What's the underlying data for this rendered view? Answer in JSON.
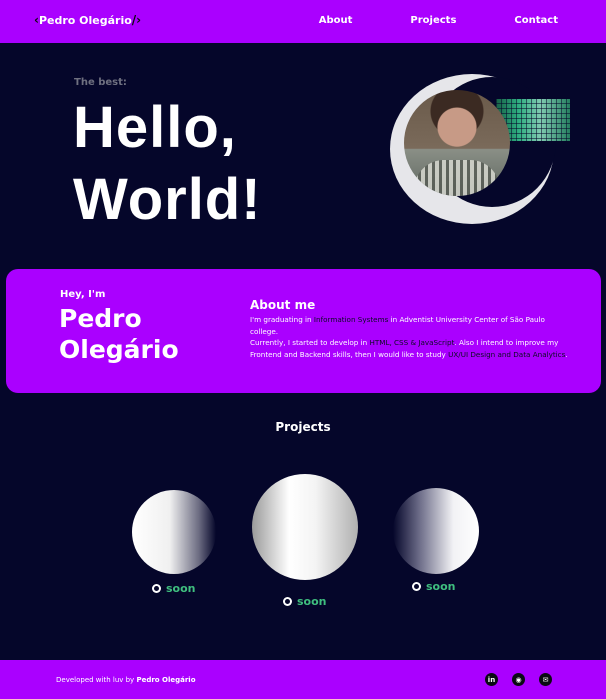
{
  "nav": {
    "logo_open": "‹",
    "logo_name": "Pedro Olegário",
    "logo_close": "/›",
    "links": [
      "About",
      "Projects",
      "Contact"
    ]
  },
  "hero": {
    "eyebrow": "The best:",
    "title_line1": "Hello,",
    "title_line2": "World!"
  },
  "about": {
    "greeting": "Hey, I'm",
    "name_line1": "Pedro",
    "name_line2": "Olegário",
    "heading": "About me",
    "p1_a": "I'm graduating in ",
    "p1_hl": "Information Systems",
    "p1_b": " in Adventist University Center of São Paulo college.",
    "p2_a": "Currently, I started to develop in ",
    "p2_hl1": "HTML, CSS & JavaScript",
    "p2_b": ". Also I intend to improve my Frontend and Backend skills, then I would like to study ",
    "p2_hl2": "UX/UI Design and Data Analytics",
    "p2_c": "."
  },
  "projects": {
    "title": "Projects",
    "items": [
      {
        "label": "soon"
      },
      {
        "label": "soon"
      },
      {
        "label": "soon"
      }
    ]
  },
  "footer": {
    "credit_prefix": "Developed with luv by ",
    "credit_name": "Pedro Olegário",
    "socials": [
      {
        "icon": "linkedin-icon",
        "glyph": "in"
      },
      {
        "icon": "github-icon",
        "glyph": "◉"
      },
      {
        "icon": "mail-icon",
        "glyph": "✉"
      }
    ]
  },
  "colors": {
    "accent": "#aa00ff",
    "background": "#05062a",
    "soon_green": "#3fbf7f"
  }
}
